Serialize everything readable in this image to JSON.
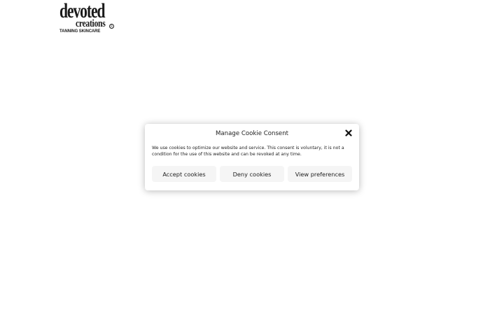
{
  "logo": {
    "line1": "devoted",
    "line2": "creations",
    "registered": "R",
    "tagline": "TANNING SKINCARE"
  },
  "cookie_dialog": {
    "title": "Manage Cookie Consent",
    "close_icon": "close-x-icon",
    "message": "We use cookies to optimize our website and service. This consent is voluntary, it is not a condition for the use of this website and can be revoked at any time.",
    "buttons": {
      "accept": "Accept cookies",
      "deny": "Deny cookies",
      "preferences": "View preferences"
    }
  },
  "colors": {
    "background": "#ffffff",
    "text": "#222222",
    "button_bg": "#f5f5f5"
  }
}
